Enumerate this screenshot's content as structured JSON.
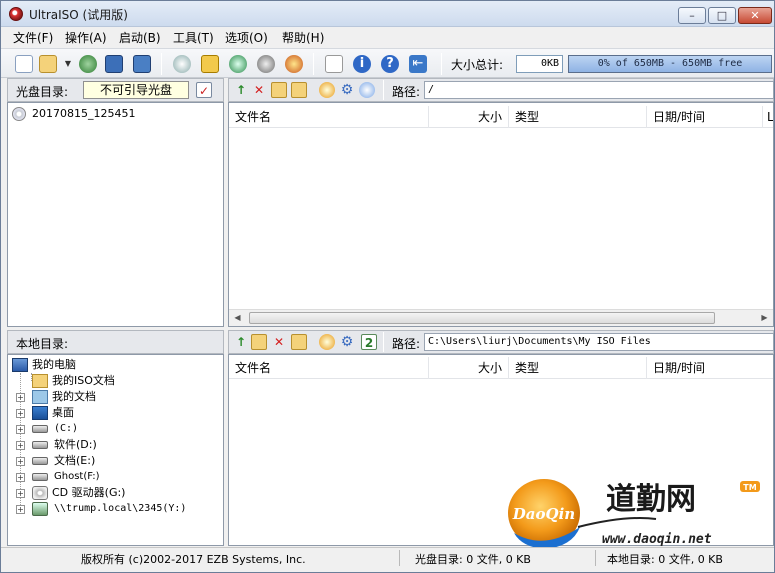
{
  "window": {
    "title": "UltraISO (试用版)"
  },
  "window_controls": {
    "minimize": "–",
    "maximize": "□",
    "close": "✕"
  },
  "menu": [
    "文件(F)",
    "操作(A)",
    "启动(B)",
    "工具(T)",
    "选项(O)",
    "帮助(H)"
  ],
  "toolbar": {
    "size_label": "大小总计:",
    "size_value": "0KB",
    "capacity_text": "0% of 650MB - 650MB free",
    "capacity_percent": 0
  },
  "disc_panel": {
    "label": "光盘目录:",
    "boot_status": "不可引导光盘",
    "tree": [
      {
        "label": "20170815_125451"
      }
    ]
  },
  "disc_files": {
    "path_label": "路径:",
    "path": "/",
    "columns": [
      "文件名",
      "大小",
      "类型",
      "日期/时间",
      "L"
    ]
  },
  "local_panel": {
    "label": "本地目录:",
    "tree": [
      {
        "label": "我的电脑"
      },
      {
        "label": "我的ISO文档"
      },
      {
        "label": "我的文档"
      },
      {
        "label": "桌面"
      },
      {
        "label": "(C:)"
      },
      {
        "label": "软件(D:)"
      },
      {
        "label": "文档(E:)"
      },
      {
        "label": "Ghost(F:)"
      },
      {
        "label": "CD 驱动器(G:)"
      },
      {
        "label": "\\\\trump.local\\2345(Y:)"
      }
    ]
  },
  "local_files": {
    "path_label": "路径:",
    "path": "C:\\Users\\liurj\\Documents\\My ISO Files",
    "columns": [
      "文件名",
      "大小",
      "类型",
      "日期/时间"
    ]
  },
  "status": {
    "copyright": "版权所有 (c)2002-2017 EZB Systems, Inc.",
    "disc_summary": "光盘目录: 0 文件, 0 KB",
    "local_summary": "本地目录: 0 文件, 0 KB"
  },
  "watermark": {
    "badge_text": "DaoQin",
    "brand_text": "道勤网",
    "tm": "TM",
    "url": "www.daoqin.net"
  },
  "colors": {
    "accent": "#8fb3e4",
    "titlebar": "#cddbee",
    "watermark_orange": "#f39a1a"
  }
}
